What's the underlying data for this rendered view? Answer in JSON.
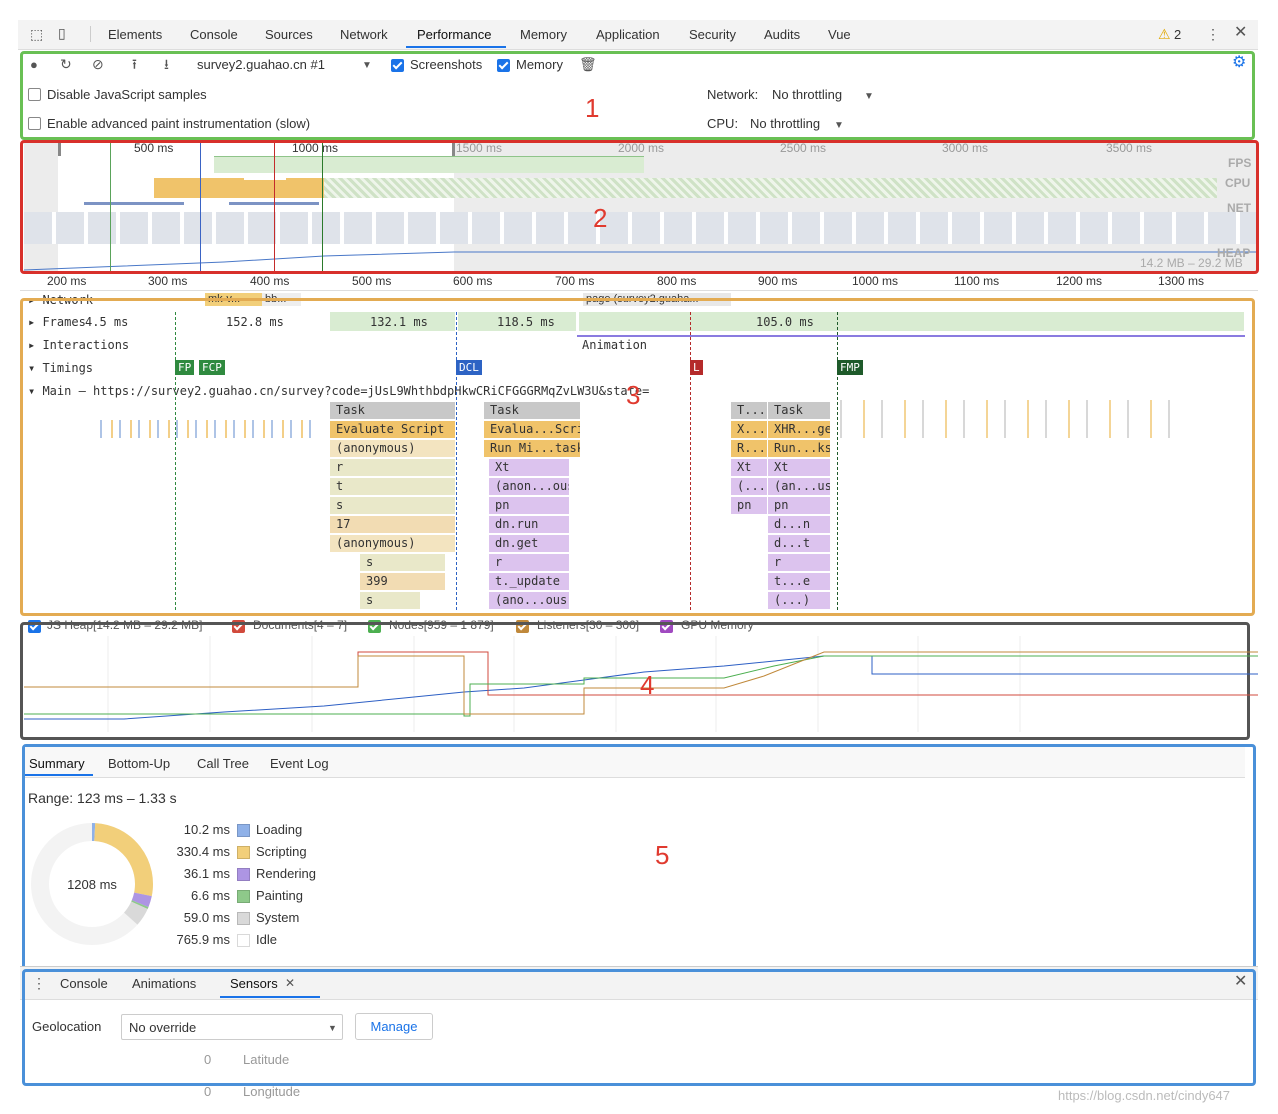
{
  "top_tabs": [
    "Elements",
    "Console",
    "Sources",
    "Network",
    "Performance",
    "Memory",
    "Application",
    "Security",
    "Audits",
    "Vue"
  ],
  "active_tab": "Performance",
  "warning_count": "2",
  "toolbar": {
    "profile_select": "survey2.guahao.cn #1",
    "screenshots_label": "Screenshots",
    "memory_label": "Memory"
  },
  "settings": {
    "disable_js_samples": "Disable JavaScript samples",
    "advanced_paint": "Enable advanced paint instrumentation (slow)",
    "network_label": "Network:",
    "network_value": "No throttling",
    "cpu_label": "CPU:",
    "cpu_value": "No throttling"
  },
  "annotations": {
    "n1": "1",
    "n2": "2",
    "n3": "3",
    "n4": "4",
    "n5": "5"
  },
  "overview": {
    "ticks": [
      "500 ms",
      "1000 ms",
      "1500 ms",
      "2000 ms",
      "2500 ms",
      "3000 ms",
      "3500 ms"
    ],
    "lane_labels": [
      "FPS",
      "CPU",
      "NET",
      "HEAP"
    ],
    "heap_range": "14.2 MB – 29.2 MB"
  },
  "ruler_ticks": [
    "200 ms",
    "300 ms",
    "400 ms",
    "500 ms",
    "600 ms",
    "700 ms",
    "800 ms",
    "900 ms",
    "1000 ms",
    "1100 ms",
    "1200 ms",
    "1300 ms"
  ],
  "tracks": {
    "network_label": "Network",
    "network_items": [
      "mk-v...",
      "bb...",
      "page (survey2.guaha..."
    ],
    "frames_label": "Frames",
    "frames_values": [
      "4.5 ms",
      "152.8 ms",
      "132.1 ms",
      "118.5 ms",
      "105.0 ms"
    ],
    "interactions_label": "Interactions",
    "animation_label": "Animation",
    "timings_label": "Timings",
    "markers": [
      "FP",
      "FCP",
      "DCL",
      "L",
      "FMP"
    ],
    "main_label": "Main — https://survey2.guahao.cn/survey?code=jUsL9WhthbdpHkwCRiCFGGGRMqZvLW3U&state="
  },
  "flame": {
    "col1": [
      "Task",
      "Evaluate Script",
      "(anonymous)",
      "r",
      "t",
      "s",
      "17",
      "(anonymous)",
      "s",
      "399",
      "s"
    ],
    "col2": [
      "Task",
      "Evalua...Script",
      "Run Mi...tasks",
      "Xt",
      "(anon...ous)",
      "pn",
      "dn.run",
      "dn.get",
      "r",
      "t._update",
      "(ano...ous)"
    ],
    "col3": [
      "T...k",
      "X...",
      "R...",
      "Xt",
      "(...)",
      "pn"
    ],
    "col4": [
      "Task",
      "XHR...ge",
      "Run...ks",
      "Xt",
      "(an...us)",
      "pn",
      "d...n",
      "d...t",
      "r",
      "t...e",
      "(...)"
    ]
  },
  "memory_legend": [
    "JS Heap[14.2 MB – 29.2 MB]",
    "Documents[4 – 7]",
    "Nodes[959 – 1 879]",
    "Listeners[30 – 300]",
    "GPU Memory"
  ],
  "summary_tabs": [
    "Summary",
    "Bottom-Up",
    "Call Tree",
    "Event Log"
  ],
  "summary": {
    "range": "Range: 123 ms – 1.33 s",
    "total": "1208 ms",
    "rows": [
      {
        "value": "10.2 ms",
        "label": "Loading",
        "color": "#8fb1e8"
      },
      {
        "value": "330.4 ms",
        "label": "Scripting",
        "color": "#f2cf7a"
      },
      {
        "value": "36.1 ms",
        "label": "Rendering",
        "color": "#ad95e3"
      },
      {
        "value": "6.6 ms",
        "label": "Painting",
        "color": "#8ec98a"
      },
      {
        "value": "59.0 ms",
        "label": "System",
        "color": "#d9d9d9"
      },
      {
        "value": "765.9 ms",
        "label": "Idle",
        "color": "#ffffff"
      }
    ]
  },
  "drawer": {
    "tabs": [
      "Console",
      "Animations",
      "Sensors"
    ],
    "active": "Sensors",
    "geolocation_label": "Geolocation",
    "geolocation_value": "No override",
    "manage_label": "Manage",
    "latitude_value": "0",
    "latitude_label": "Latitude",
    "longitude_value": "0",
    "longitude_label": "Longitude"
  },
  "watermark": "https://blog.csdn.net/cindy647"
}
